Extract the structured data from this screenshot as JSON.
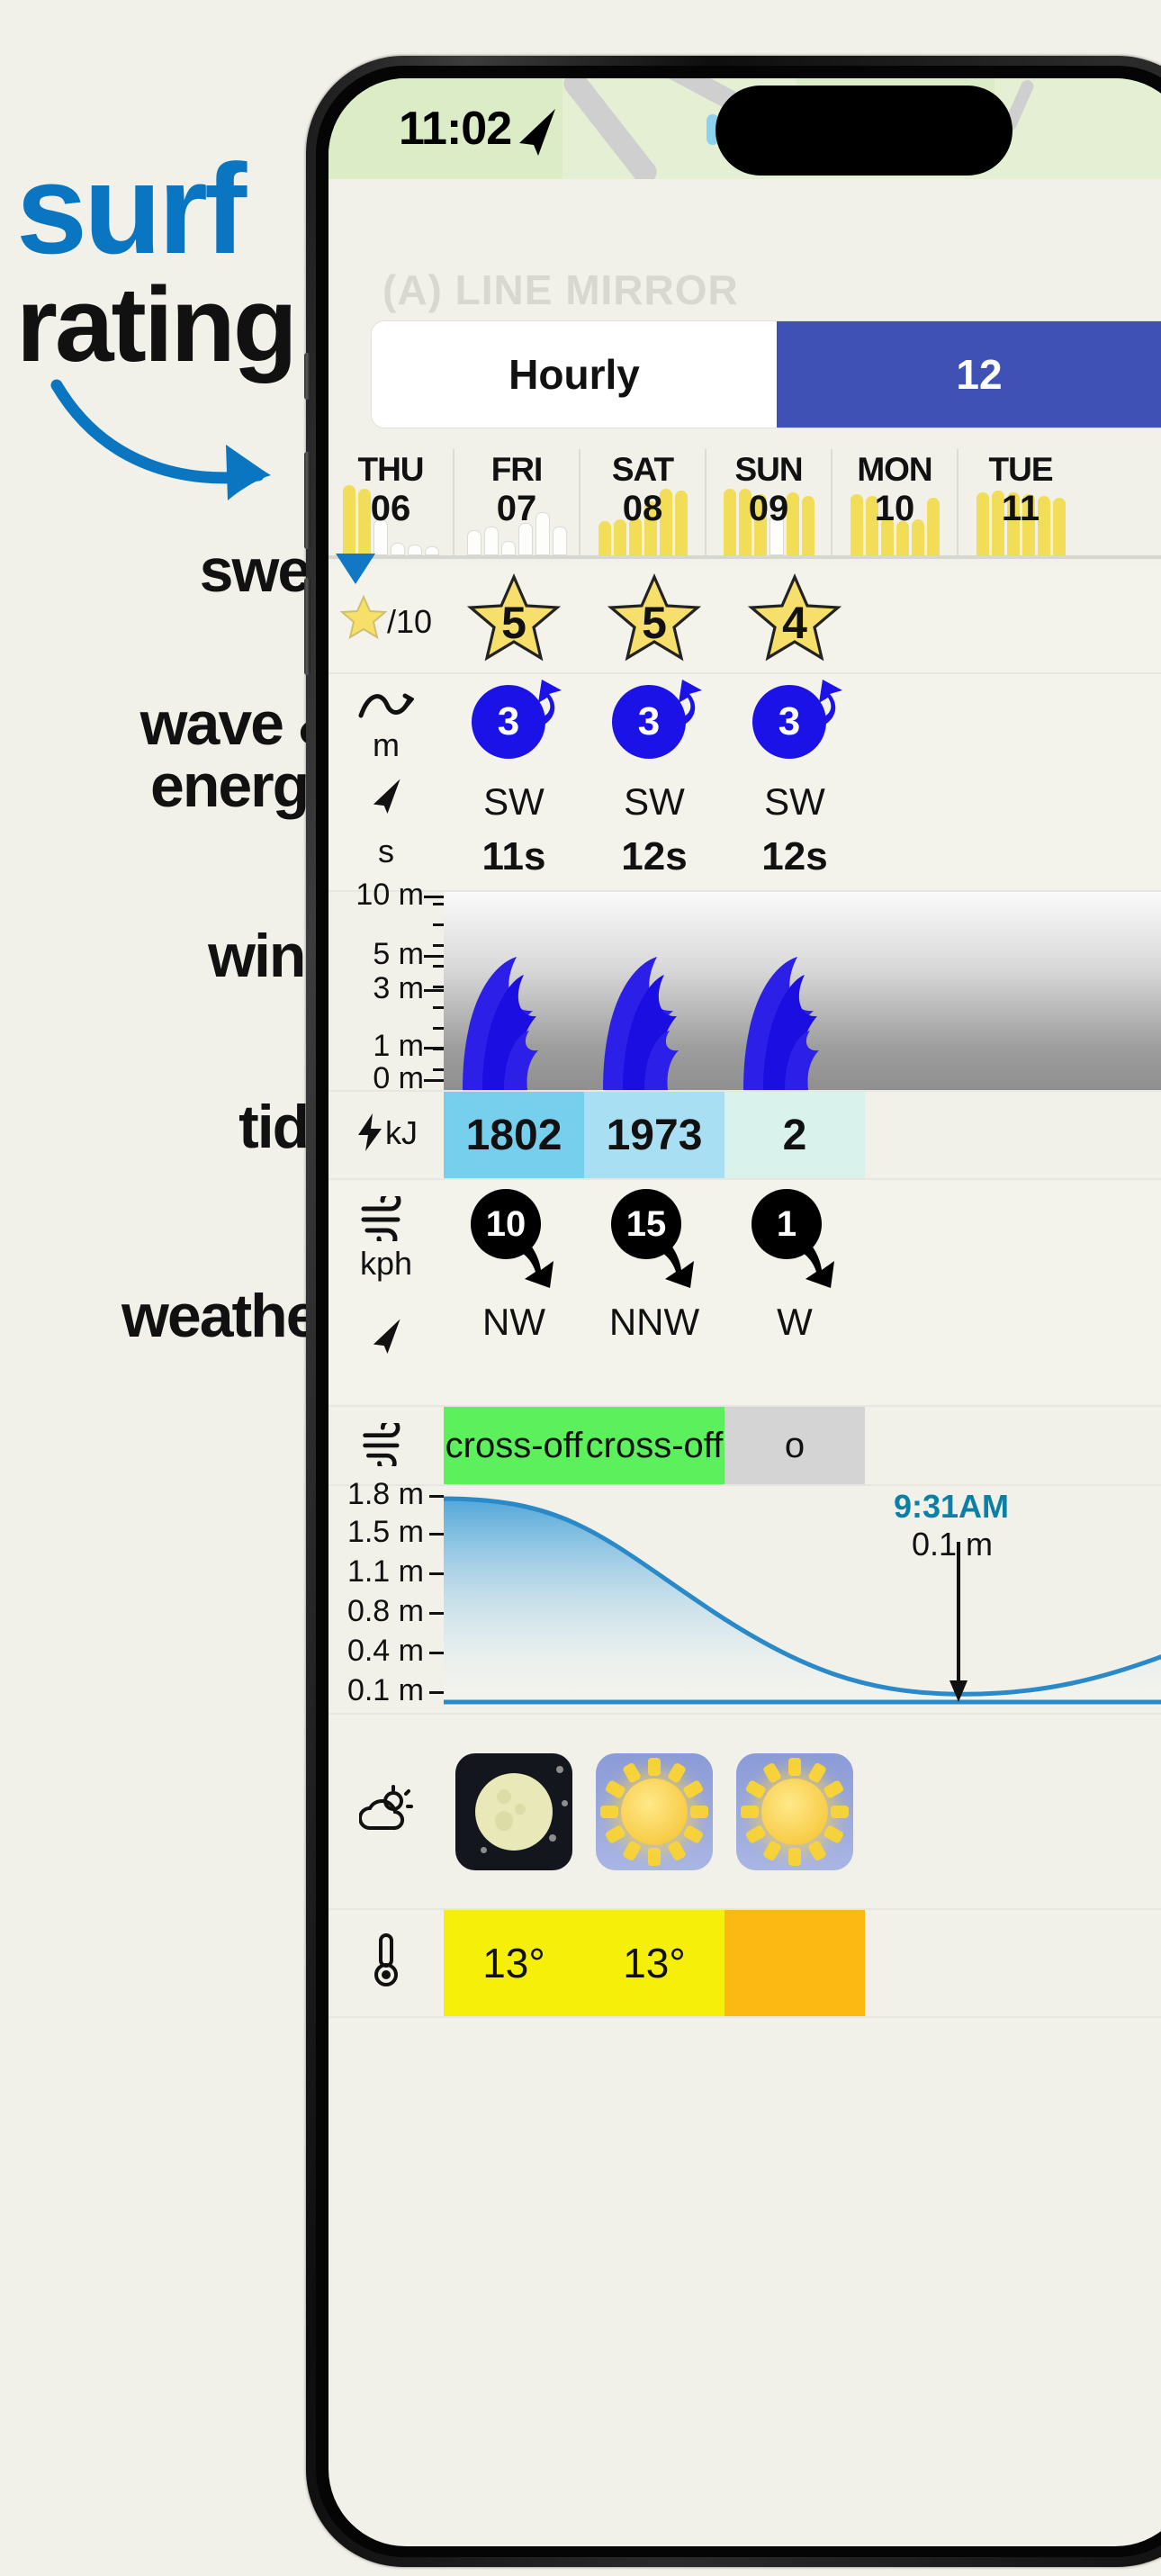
{
  "promo": {
    "line1": "surf",
    "line2": "rating",
    "items": [
      "swell",
      "wave & energy",
      "wind",
      "tide",
      "weather"
    ],
    "accent_blue": "#0a76c2",
    "text_black": "#111111",
    "background": "#f1f1e9"
  },
  "phone": {
    "status": {
      "time": "11:02",
      "location_icon": "location-arrow-icon"
    },
    "faded_title": "(A) LINE MIRROR"
  },
  "tabs": {
    "items": [
      {
        "label": "Hourly",
        "state": "active"
      },
      {
        "label": "12",
        "state": "selected"
      }
    ]
  },
  "day_strip": {
    "days": [
      {
        "name": "THU",
        "num": "06",
        "bars": [
          "y",
          "y",
          "w",
          "w",
          "w",
          "w"
        ],
        "heights": [
          78,
          74,
          38,
          12,
          10,
          8
        ],
        "types": [
          "y",
          "y",
          "w",
          "w",
          "w",
          "w"
        ]
      },
      {
        "name": "FRI",
        "num": "07",
        "bars": [
          "w",
          "w",
          "w",
          "w",
          "w",
          "w"
        ],
        "heights": [
          26,
          30,
          14,
          34,
          46,
          30
        ],
        "types": [
          "w",
          "w",
          "w",
          "w",
          "w",
          "w"
        ]
      },
      {
        "name": "SAT",
        "num": "08",
        "bars": [
          "y",
          "y",
          "y",
          "y",
          "y",
          "y"
        ],
        "heights": [
          38,
          40,
          42,
          60,
          74,
          72
        ],
        "types": [
          "y",
          "y",
          "y",
          "y",
          "y",
          "y"
        ]
      },
      {
        "name": "SUN",
        "num": "09",
        "bars": [
          "y",
          "y",
          "y",
          "w",
          "y",
          "y"
        ],
        "heights": [
          74,
          74,
          68,
          44,
          70,
          66
        ],
        "types": [
          "y",
          "y",
          "y",
          "w",
          "y",
          "y"
        ]
      },
      {
        "name": "MON",
        "num": "10",
        "bars": [
          "y",
          "y",
          "y",
          "y",
          "y",
          "y"
        ],
        "heights": [
          68,
          66,
          42,
          38,
          40,
          64
        ],
        "types": [
          "y",
          "y",
          "y",
          "y",
          "y",
          "y"
        ]
      },
      {
        "name": "TUE",
        "num": "11",
        "bars": [
          "y",
          "y",
          "y",
          "y",
          "y",
          "y"
        ],
        "heights": [
          70,
          72,
          70,
          68,
          66,
          64
        ],
        "types": [
          "y",
          "y",
          "y",
          "y",
          "y",
          "y"
        ]
      }
    ],
    "today_marker": true,
    "bar_color_high": "#f2dd59",
    "bar_color_low": "#fdfdfb"
  },
  "rows": {
    "rating": {
      "gutter_label": "/10",
      "gutter_icon": "star-icon",
      "values": [
        "5",
        "5",
        "4"
      ]
    },
    "swell": {
      "gutter_icon": "swell-wave-icon",
      "unit": "m",
      "dir_icon": "direction-arrow-icon",
      "period_unit": "s",
      "sizes": [
        "3",
        "3",
        "3"
      ],
      "compass": [
        "SW",
        "SW",
        "SW"
      ],
      "periods": [
        "11s",
        "12s",
        "12s"
      ],
      "dir_color": "#1b12e8"
    },
    "wave": {
      "ticks": [
        "10 m",
        "5 m",
        "3 m",
        "1 m",
        "0 m"
      ],
      "heights": [
        2.6,
        2.7,
        2.6
      ]
    },
    "energy": {
      "gutter_icon": "bolt-icon",
      "unit": "kJ",
      "values": [
        "1802",
        "1973",
        "2"
      ],
      "cell_colors": [
        "#77cfee",
        "#a8dff2",
        "#d9f2ec"
      ]
    },
    "wind": {
      "gutter_icon": "wind-icon",
      "unit": "kph",
      "dir_icon": "direction-arrow-icon",
      "speeds": [
        "10",
        "15",
        "1"
      ],
      "compass": [
        "NW",
        "NNW",
        "W"
      ],
      "disc_color": "#000000"
    },
    "cross": {
      "gutter_icon": "wind-icon",
      "values": [
        "cross-off",
        "cross-off",
        "o"
      ],
      "colors": [
        "#5df05d",
        "#5df05d",
        "#d4d4d4"
      ]
    },
    "tide": {
      "ticks": [
        "1.8 m",
        "1.5 m",
        "1.1 m",
        "0.8 m",
        "0.4 m",
        "0.1 m"
      ],
      "low_time": "9:31AM",
      "low_height": "0.1 m",
      "line_color": "#2a89c8"
    },
    "weather": {
      "gutter_icon": "cloud-sun-icon",
      "icons": [
        "moon-night-icon",
        "sun-day-icon",
        "sun-day-icon"
      ]
    },
    "temperature": {
      "gutter_icon": "thermometer-icon",
      "values": [
        "13°",
        "13°",
        ""
      ],
      "cell_colors": [
        "#f5ef0a",
        "#f5ef0a",
        "#fcb813"
      ]
    }
  }
}
